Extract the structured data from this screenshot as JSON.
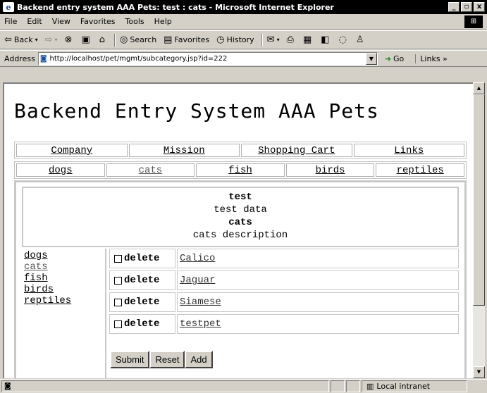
{
  "window": {
    "title": "Backend entry system AAA Pets: test : cats - Microsoft Internet Explorer",
    "icon": "e",
    "minimize": "_",
    "maximize": "▫",
    "close": "x"
  },
  "menu": {
    "items": [
      "File",
      "Edit",
      "View",
      "Favorites",
      "Tools",
      "Help"
    ]
  },
  "toolbar": {
    "back": "Back",
    "search": "Search",
    "favorites": "Favorites",
    "history": "History"
  },
  "address": {
    "label": "Address",
    "url": "http://localhost/pet/mgmt/subcategory.jsp?id=222",
    "go": "Go",
    "links": "Links »"
  },
  "page": {
    "site_title": "Backend Entry System AAA Pets",
    "top_nav": [
      "Company",
      "Mission",
      "Shopping Cart",
      "Links"
    ],
    "category_nav": [
      "dogs",
      "cats",
      "fish",
      "birds",
      "reptiles"
    ],
    "header": {
      "name": "test",
      "description": "test data",
      "subcategory": "cats",
      "subcategory_description": "cats description"
    },
    "side_links": [
      "dogs",
      "cats",
      "fish",
      "birds",
      "reptiles"
    ],
    "delete_label": "delete",
    "pets": [
      "Calico",
      "Jaguar",
      "Siamese",
      "testpet"
    ],
    "buttons": {
      "submit": "Submit",
      "reset": "Reset",
      "add": "Add"
    }
  },
  "status": {
    "zone": "Local intranet"
  }
}
